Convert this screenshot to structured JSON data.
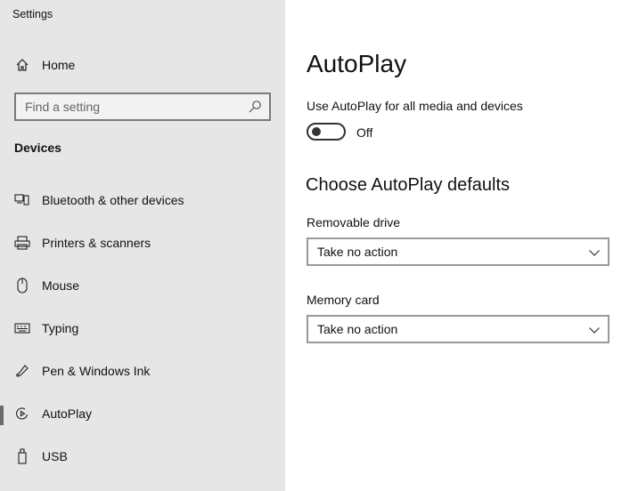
{
  "window": {
    "title": "Settings"
  },
  "sidebar": {
    "home_label": "Home",
    "search_placeholder": "Find a setting",
    "section_header": "Devices",
    "items": [
      {
        "label": "Bluetooth & other devices",
        "icon": "bluetooth-devices-icon"
      },
      {
        "label": "Printers & scanners",
        "icon": "printer-icon"
      },
      {
        "label": "Mouse",
        "icon": "mouse-icon"
      },
      {
        "label": "Typing",
        "icon": "keyboard-icon"
      },
      {
        "label": "Pen & Windows Ink",
        "icon": "pen-icon"
      },
      {
        "label": "AutoPlay",
        "icon": "autoplay-icon",
        "selected": true
      },
      {
        "label": "USB",
        "icon": "usb-icon"
      }
    ]
  },
  "main": {
    "title": "AutoPlay",
    "toggle": {
      "caption": "Use AutoPlay for all media and devices",
      "state_label": "Off",
      "on": false
    },
    "defaults_title": "Choose AutoPlay defaults",
    "removable": {
      "label": "Removable drive",
      "value": "Take no action"
    },
    "memory_card": {
      "label": "Memory card",
      "value": "Take no action"
    }
  },
  "colors": {
    "sidebar_bg": "#e6e6e6",
    "main_bg": "#ffffff",
    "selection_bar": "#6b6b6b"
  }
}
